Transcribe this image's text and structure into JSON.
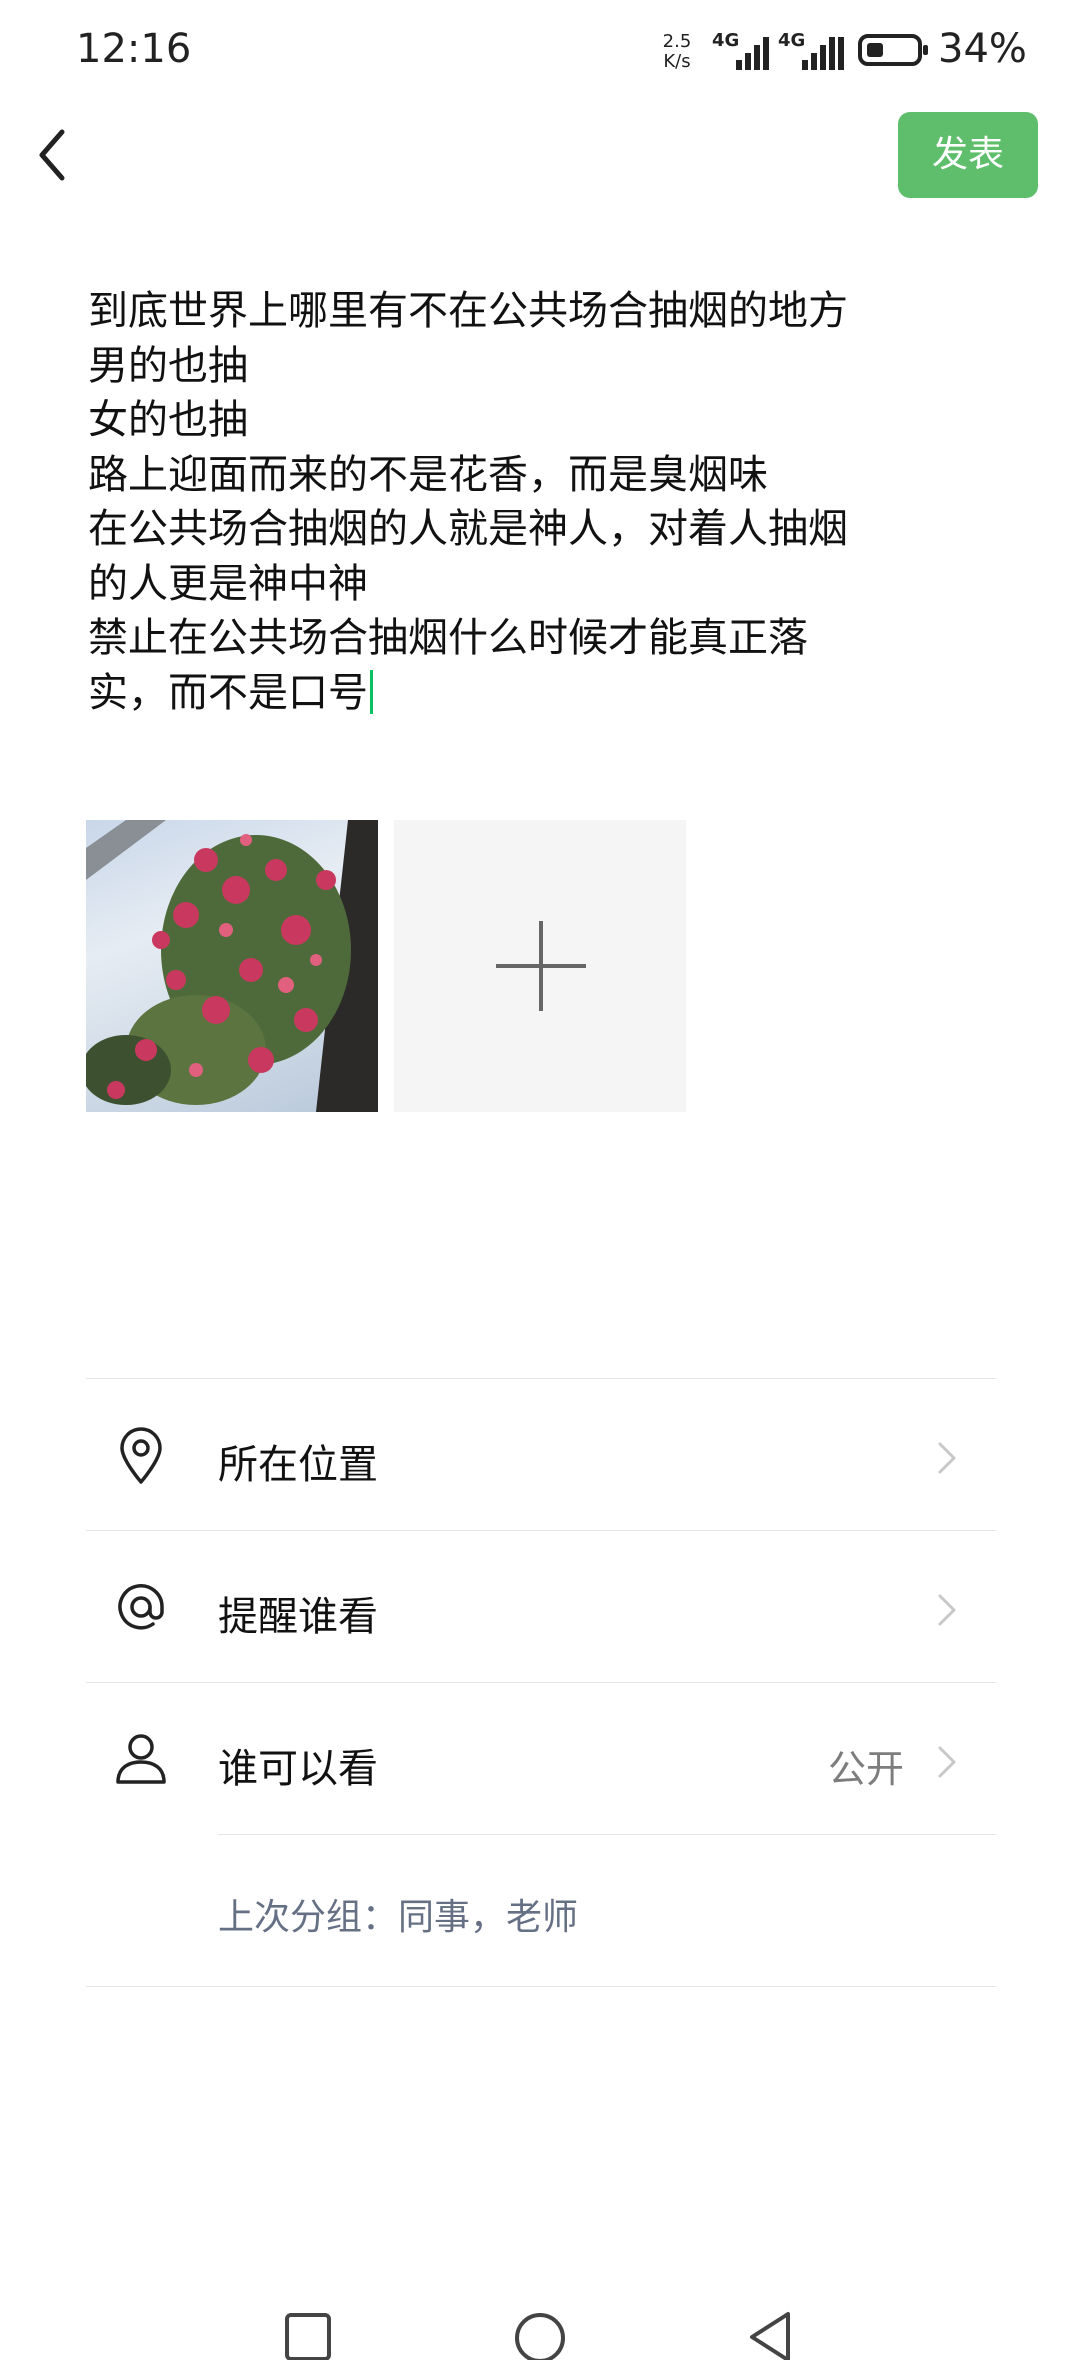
{
  "status_bar": {
    "time": "12:16",
    "net_speed_value": "2.5",
    "net_speed_unit": "K/s",
    "network_1": "4G",
    "network_2": "4G",
    "battery_percent": "34%",
    "battery_level": 0.34
  },
  "header": {
    "back_icon": "chevron-left-icon",
    "publish_label": "发表",
    "accent_color": "#5fbe6b"
  },
  "post": {
    "lines": [
      "到底世界上哪里有不在公共场合抽烟的地方",
      "男的也抽",
      "女的也抽",
      "路上迎面而来的不是花香，而是臭烟味",
      "在公共场合抽烟的人就是神人，对着人抽烟",
      "的人更是神中神",
      "禁止在公共场合抽烟什么时候才能真正落",
      "实，而不是口号"
    ]
  },
  "images": {
    "photo_icon": "flower-photo",
    "add_icon": "plus-icon"
  },
  "options": {
    "location": {
      "label": "所在位置",
      "icon": "location-pin-icon"
    },
    "remind": {
      "label": "提醒谁看",
      "icon": "at-sign-icon"
    },
    "visibility": {
      "label": "谁可以看",
      "value": "公开",
      "icon": "person-icon"
    },
    "last_group": "上次分组：同事，老师"
  },
  "nav_bar": {
    "recents_icon": "square-icon",
    "home_icon": "circle-icon",
    "back_icon": "triangle-back-icon"
  }
}
